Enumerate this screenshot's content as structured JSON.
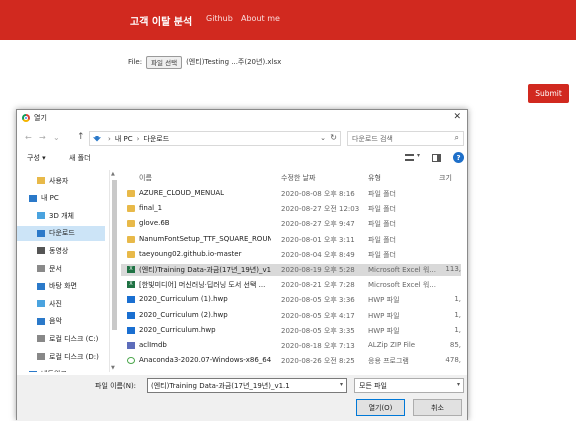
{
  "navbar": {
    "brand": "고객 이탈 분석",
    "links": [
      "Github",
      "About me"
    ]
  },
  "file_input": {
    "label": "File:",
    "button": "파일 선택",
    "filename": "(엔티)Testing ...주(20년).xlsx"
  },
  "submit_button": "Submit",
  "dialog": {
    "title": "열기",
    "close": "✕",
    "nav_back": "←",
    "nav_forward": "→",
    "nav_dropdown": "⌄",
    "nav_up": "↑",
    "path": [
      "내 PC",
      "다운로드"
    ],
    "path_separator": "›",
    "search_placeholder": "다운로드 검색",
    "toolbar": {
      "organize": "구성 ▾",
      "new_folder": "새 폴더",
      "help": "?"
    },
    "nav_pane": [
      {
        "label": "사용자",
        "icon": "folder-icon",
        "selected": false
      },
      {
        "label": "내 PC",
        "icon": "computer-icon",
        "selected": false
      },
      {
        "label": "3D 개체",
        "icon": "cube-icon",
        "selected": false
      },
      {
        "label": "다운로드",
        "icon": "download-icon",
        "selected": true
      },
      {
        "label": "동영상",
        "icon": "video-icon",
        "selected": false
      },
      {
        "label": "문서",
        "icon": "document-icon",
        "selected": false
      },
      {
        "label": "바탕 화면",
        "icon": "desktop-icon",
        "selected": false
      },
      {
        "label": "사진",
        "icon": "picture-icon",
        "selected": false
      },
      {
        "label": "음악",
        "icon": "music-icon",
        "selected": false
      },
      {
        "label": "로컬 디스크 (C:)",
        "icon": "drive-icon",
        "selected": false
      },
      {
        "label": "로컬 디스크 (D:)",
        "icon": "drive-icon",
        "selected": false
      },
      {
        "label": "네트워크",
        "icon": "network-icon",
        "selected": false
      }
    ],
    "columns": {
      "name": "이름",
      "date": "수정한 날짜",
      "type": "유형",
      "size": "크기"
    },
    "files": [
      {
        "name": "AZURE_CLOUD_MENUAL",
        "date": "2020-08-08 오후 8:16",
        "type": "파일 폴더",
        "size": "",
        "icon": "folder",
        "selected": false
      },
      {
        "name": "final_1",
        "date": "2020-08-27 오전 12:03",
        "type": "파일 폴더",
        "size": "",
        "icon": "folder",
        "selected": false
      },
      {
        "name": "glove.6B",
        "date": "2020-08-27 오후 9:47",
        "type": "파일 폴더",
        "size": "",
        "icon": "folder",
        "selected": false
      },
      {
        "name": "NanumFontSetup_TTF_SQUARE_ROUND",
        "date": "2020-08-01 오후 3:11",
        "type": "파일 폴더",
        "size": "",
        "icon": "folder",
        "selected": false
      },
      {
        "name": "taeyoung02.github.io-master",
        "date": "2020-08-04 오후 8:49",
        "type": "파일 폴더",
        "size": "",
        "icon": "folder",
        "selected": false
      },
      {
        "name": "(엔티)Training Data-과금(17년_19년)_v1.1",
        "date": "2020-08-19 오후 5:28",
        "type": "Microsoft Excel 워...",
        "size": "113,",
        "icon": "excel",
        "selected": true
      },
      {
        "name": "[한빛미디어] 머신러닝·딥러닝 도서 선택 ...",
        "date": "2020-08-21 오후 7:28",
        "type": "Microsoft Excel 워...",
        "size": "",
        "icon": "excel",
        "selected": false
      },
      {
        "name": "2020_Curriculum (1).hwp",
        "date": "2020-08-05 오후 3:36",
        "type": "HWP 파일",
        "size": "1,",
        "icon": "hwp",
        "selected": false
      },
      {
        "name": "2020_Curriculum (2).hwp",
        "date": "2020-08-05 오후 4:17",
        "type": "HWP 파일",
        "size": "1,",
        "icon": "hwp",
        "selected": false
      },
      {
        "name": "2020_Curriculum.hwp",
        "date": "2020-08-05 오후 3:35",
        "type": "HWP 파일",
        "size": "1,",
        "icon": "hwp",
        "selected": false
      },
      {
        "name": "aclImdb",
        "date": "2020-08-18 오후 7:13",
        "type": "ALZip ZIP File",
        "size": "85,",
        "icon": "zip",
        "selected": false
      },
      {
        "name": "Anaconda3-2020.07-Windows-x86_64 (1)",
        "date": "2020-08-26 오전 8:25",
        "type": "응용 프로그램",
        "size": "478,",
        "icon": "exe",
        "selected": false
      }
    ],
    "filename_label": "파일 이름(N):",
    "filename_value": "(엔티)Training Data-과금(17년_19년)_v1.1",
    "filetype_value": "모든 파일",
    "open_button": "열기(O)",
    "cancel_button": "취소"
  },
  "colors": {
    "brand_red": "#d1291f",
    "selection_blue": "#cce4f7",
    "selected_row": "#d9d9d9"
  }
}
